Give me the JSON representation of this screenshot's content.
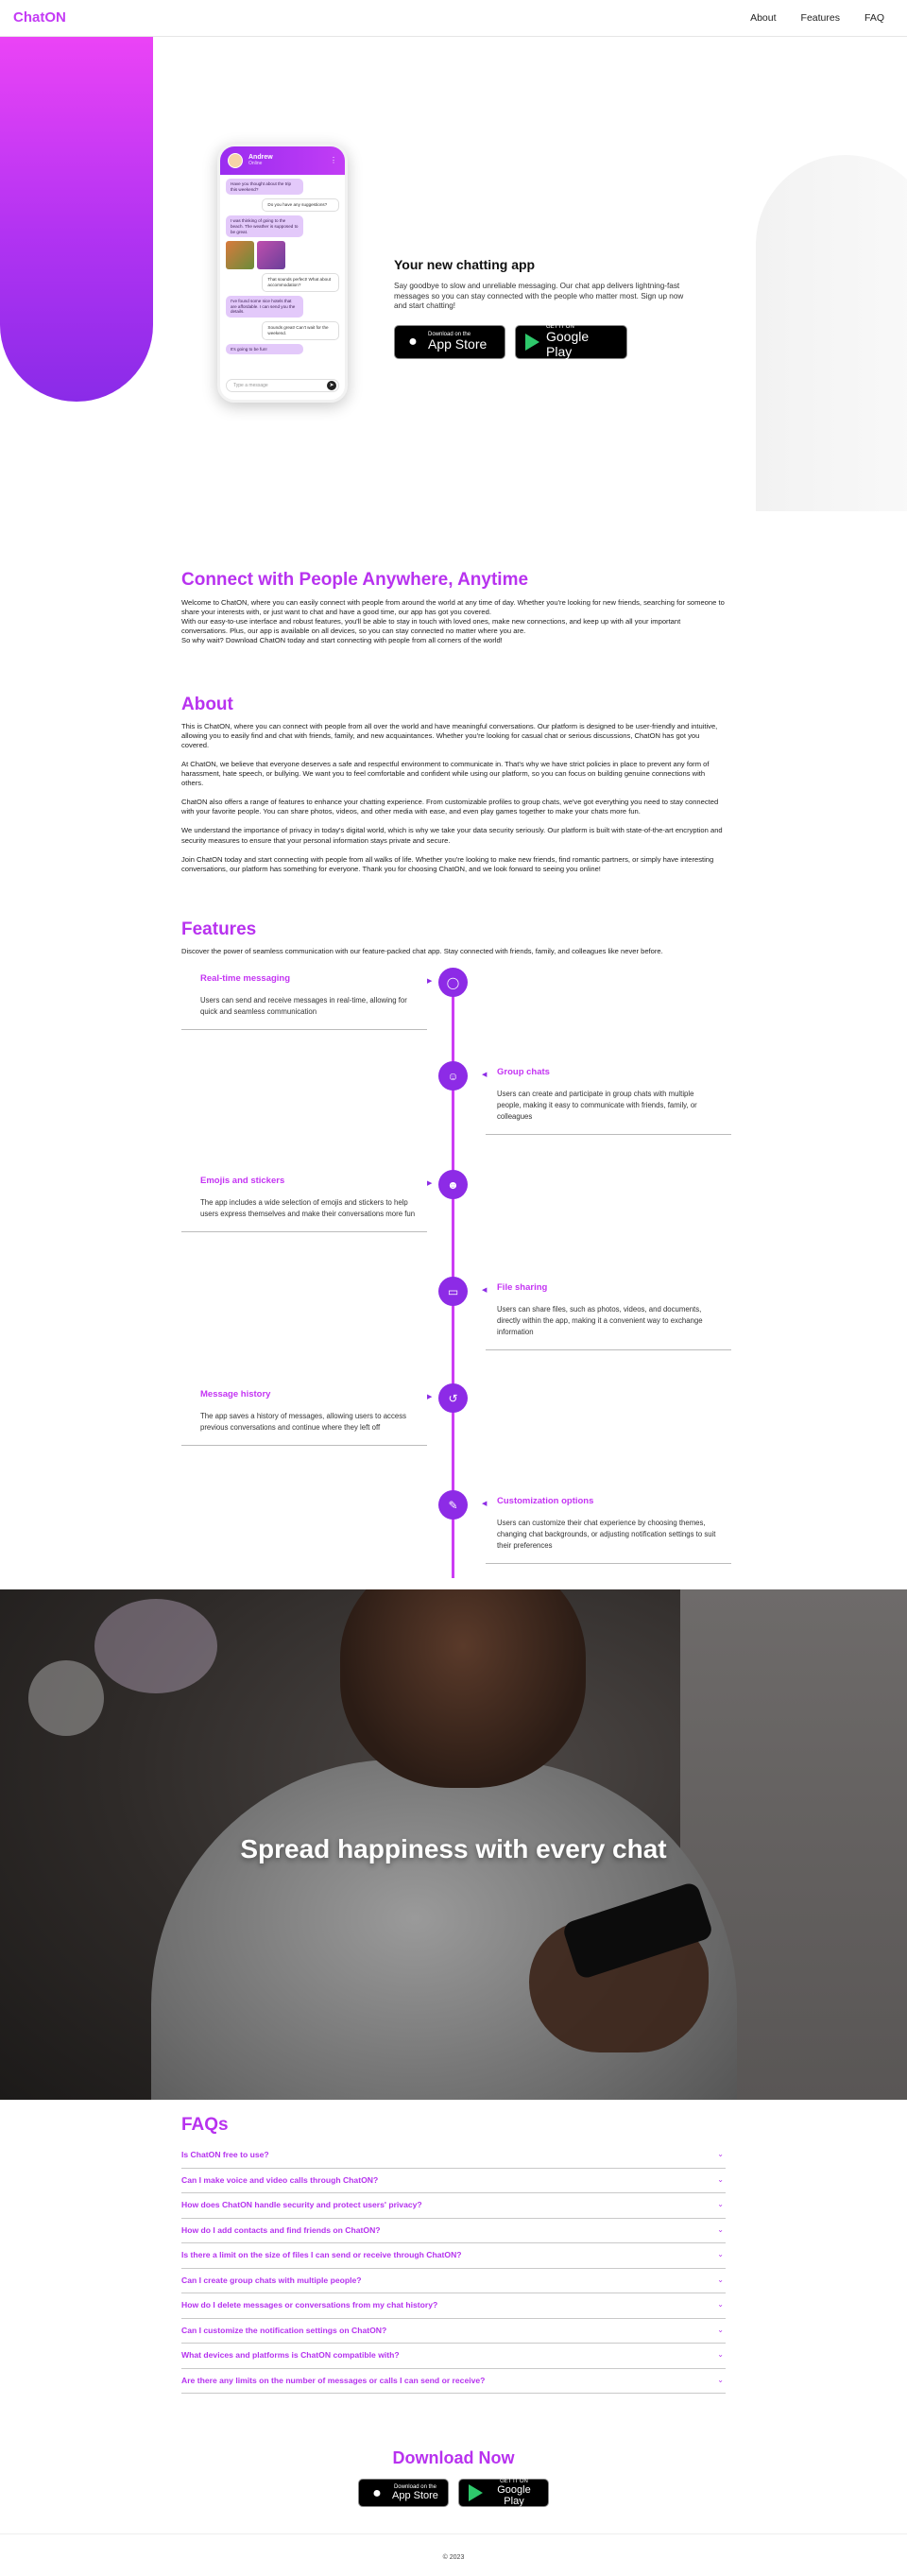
{
  "nav": {
    "logo": "ChatON",
    "links": [
      "About",
      "Features",
      "FAQ"
    ]
  },
  "hero": {
    "title": "Your new chatting app",
    "description": "Say goodbye to slow and unreliable messaging. Our chat app delivers lightning-fast messages so you can stay connected with the people who matter most. Sign up now and start chatting!",
    "phone": {
      "contact_name": "Andrew",
      "contact_status": "Online",
      "messages": [
        {
          "dir": "in",
          "text": "Have you thought about the trip this weekend?"
        },
        {
          "dir": "out",
          "text": "Do you have any suggestions?"
        },
        {
          "dir": "in",
          "text": "I was thinking of going to the beach. The weather is supposed to be great."
        },
        {
          "dir": "out",
          "text": "That sounds perfect! What about accommodation?"
        },
        {
          "dir": "in",
          "text": "I've found some nice hotels that are affordable. I can send you the details."
        },
        {
          "dir": "out",
          "text": "Sounds great! Can't wait for the weekend."
        },
        {
          "dir": "in",
          "text": "It's going to be fun!"
        }
      ],
      "input_placeholder": "Type a message"
    },
    "stores": {
      "apple_small": "Download on the",
      "apple_large": "App Store",
      "google_small": "GET IT ON",
      "google_large": "Google Play"
    }
  },
  "connect": {
    "title": "Connect with People Anywhere, Anytime",
    "lines": [
      "Welcome to ChatON, where you can easily connect with people from around the world at any time of day. Whether you're looking for new friends, searching for someone to share your interests with, or just want to chat and have a good time, our app has got you covered.",
      "With our easy-to-use interface and robust features, you'll be able to stay in touch with loved ones, make new connections, and keep up with all your important conversations. Plus, our app is available on all devices, so you can stay connected no matter where you are.",
      "So why wait? Download ChatON today and start connecting with people from all corners of the world!"
    ]
  },
  "about": {
    "title": "About",
    "paragraphs": [
      "This is ChatON, where you can connect with people from all over the world and have meaningful conversations. Our platform is designed to be user-friendly and intuitive, allowing you to easily find and chat with friends, family, and new acquaintances. Whether you're looking for casual chat or serious discussions, ChatON has got you covered.",
      "At ChatON, we believe that everyone deserves a safe and respectful environment to communicate in. That's why we have strict policies in place to prevent any form of harassment, hate speech, or bullying. We want you to feel comfortable and confident while using our platform, so you can focus on building genuine connections with others.",
      "ChatON also offers a range of features to enhance your chatting experience. From customizable profiles to group chats, we've got everything you need to stay connected with your favorite people. You can share photos, videos, and other media with ease, and even play games together to make your chats more fun.",
      "We understand the importance of privacy in today's digital world, which is why we take your data security seriously. Our platform is built with state-of-the-art encryption and security measures to ensure that your personal information stays private and secure.",
      "Join ChatON today and start connecting with people from all walks of life. Whether you're looking to make new friends, find romantic partners, or simply have interesting conversations, our platform has something for everyone. Thank you for choosing ChatON, and we look forward to seeing you online!"
    ]
  },
  "features": {
    "title": "Features",
    "intro": "Discover the power of seamless communication with our feature-packed chat app. Stay connected with friends, family, and colleagues like never before.",
    "items": [
      {
        "title": "Real-time messaging",
        "text": "Users can send and receive messages in real-time, allowing for quick and seamless communication",
        "icon": "chat-bubble-icon"
      },
      {
        "title": "Group chats",
        "text": "Users can create and participate in group chats with multiple people, making it easy to communicate with friends, family, or colleagues",
        "icon": "group-icon"
      },
      {
        "title": "Emojis and stickers",
        "text": "The app includes a wide selection of emojis and stickers to help users express themselves and make their conversations more fun",
        "icon": "emoji-icon"
      },
      {
        "title": "File sharing",
        "text": "Users can share files, such as photos, videos, and documents, directly within the app, making it a convenient way to exchange information",
        "icon": "folder-share-icon"
      },
      {
        "title": "Message history",
        "text": "The app saves a history of messages, allowing users to access previous conversations and continue where they left off",
        "icon": "history-icon"
      },
      {
        "title": "Customization options",
        "text": "Users can customize their chat experience by choosing themes, changing chat backgrounds, or adjusting notification settings to suit their preferences",
        "icon": "brush-icon"
      }
    ]
  },
  "banner": {
    "text": "Spread happiness with every chat"
  },
  "faq": {
    "title": "FAQs",
    "questions": [
      "Is ChatON free to use?",
      "Can I make voice and video calls through ChatON?",
      "How does ChatON handle security and protect users' privacy?",
      "How do I add contacts and find friends on ChatON?",
      "Is there a limit on the size of files I can send or receive through ChatON?",
      "Can I create group chats with multiple people?",
      "How do I delete messages or conversations from my chat history?",
      "Can I customize the notification settings on ChatON?",
      "What devices and platforms is ChatON compatible with?",
      "Are there any limits on the number of messages or calls I can send or receive?"
    ]
  },
  "download": {
    "title": "Download Now"
  },
  "footer": {
    "text": "© 2023"
  },
  "colors": {
    "accent": "#b832ef",
    "accent_dark": "#8d2be6",
    "gradient_start": "#ee44f6"
  }
}
